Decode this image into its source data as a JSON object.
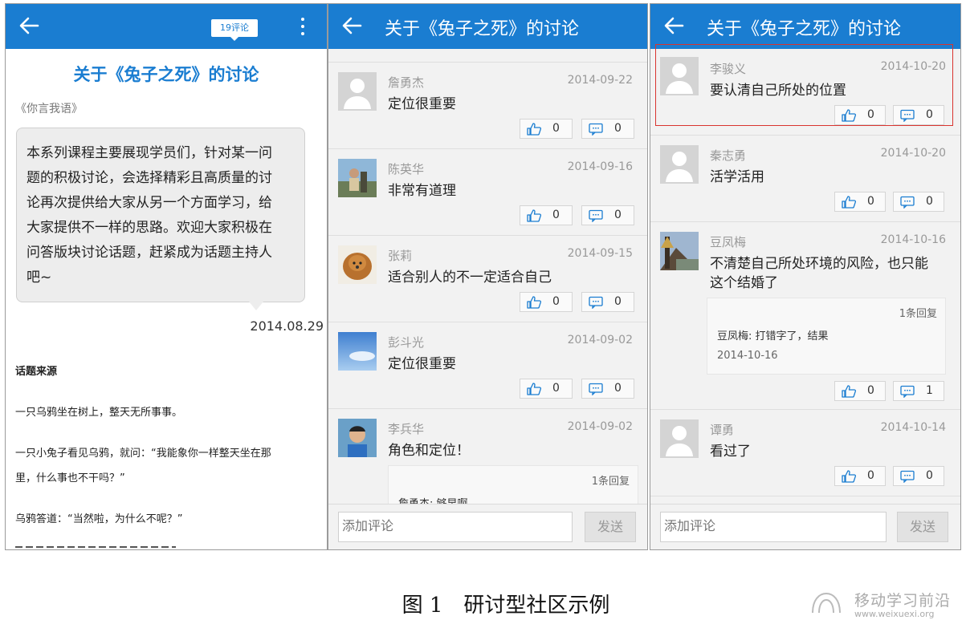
{
  "screen1": {
    "comment_badge": "19评论",
    "article_title": "关于《兔子之死》的讨论",
    "source": "《你言我语》",
    "intro_lines": [
      "本系列课程主要展现学员们，针对某一问",
      "题的积极讨论，会选择精彩且高质量的讨",
      "论再次提供给大家从另一个方面学习，给",
      "大家提供不一样的思路。欢迎大家积极在",
      "问答版块讨论话题，赶紧成为话题主持人",
      "吧~"
    ],
    "date": "2014.08.29",
    "section_title": "话题来源",
    "paragraphs": [
      "一只乌鸦坐在树上，整天无所事事。",
      "一只小兔子看见乌鸦，就问：“我能象你一样整天坐在那",
      "里，什么事也不干吗？”",
      "乌鸦答道：“当然啦，为什么不呢？”"
    ]
  },
  "screen2": {
    "title": "关于《兔子之死》的讨论",
    "comments": [
      {
        "name": "詹勇杰",
        "date": "2014-09-22",
        "text": "定位很重要",
        "likes": "0",
        "replies": "0"
      },
      {
        "name": "陈英华",
        "date": "2014-09-16",
        "text": "非常有道理",
        "likes": "0",
        "replies": "0"
      },
      {
        "name": "张莉",
        "date": "2014-09-15",
        "text": "适合别人的不一定适合自己",
        "likes": "0",
        "replies": "0"
      },
      {
        "name": "彭斗光",
        "date": "2014-09-02",
        "text": "定位很重要",
        "likes": "0",
        "replies": "0"
      },
      {
        "name": "李兵华",
        "date": "2014-09-02",
        "text": "角色和定位！",
        "reply_count": "1条回复",
        "reply_text": "詹勇杰: 够早啊"
      }
    ],
    "input_placeholder": "添加评论",
    "send_label": "发送"
  },
  "screen3": {
    "title": "关于《兔子之死》的讨论",
    "comments": [
      {
        "name": "李骏义",
        "date": "2014-10-20",
        "text": "要认清自己所处的位置",
        "likes": "0",
        "replies": "0"
      },
      {
        "name": "秦志勇",
        "date": "2014-10-20",
        "text": "活学活用",
        "likes": "0",
        "replies": "0"
      },
      {
        "name": "豆凤梅",
        "date": "2014-10-16",
        "text_line1": "不清楚自己所处环境的风险，也只能",
        "text_line2": "这个结婚了",
        "reply_count": "1条回复",
        "reply_text": "豆凤梅: 打错字了，结果",
        "reply_date": "2014-10-16",
        "likes": "0",
        "replies": "1"
      },
      {
        "name": "谭勇",
        "date": "2014-10-14",
        "text": "看过了",
        "likes": "0",
        "replies": "0"
      }
    ],
    "input_placeholder": "添加评论",
    "send_label": "发送"
  },
  "caption": "图 1　研讨型社区示例",
  "watermark": {
    "name": "移动学习前沿",
    "url": "www.weixuexi.org"
  },
  "colors": {
    "brand": "#1a7dd1",
    "highlight": "#d9342f",
    "list_bg": "#f2f2f2"
  },
  "icons": [
    "back-arrow-icon",
    "more-vert-icon",
    "thumbs-up-icon",
    "comment-icon",
    "avatar-placeholder-icon"
  ]
}
